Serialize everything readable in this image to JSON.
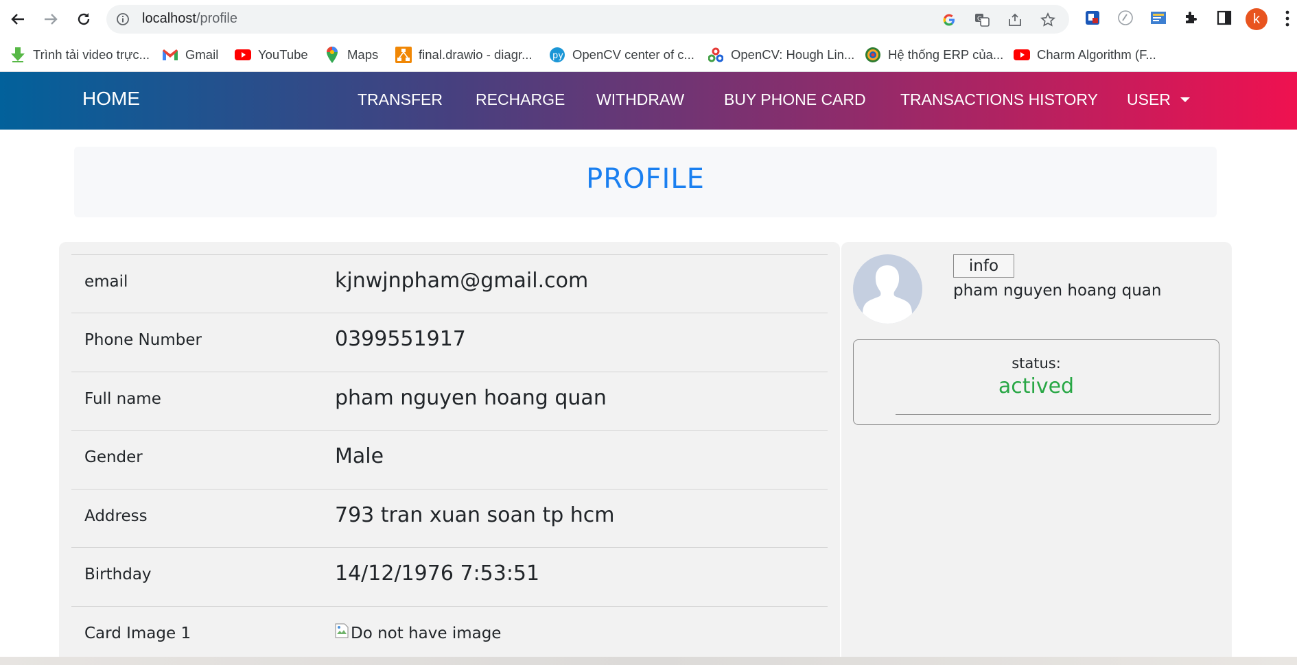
{
  "browser": {
    "url_host": "localhost",
    "url_path": "/profile",
    "profile_initial": "k",
    "bookmarks": [
      {
        "label": "Trình tải video trực...",
        "icon": "download-arrow-icon"
      },
      {
        "label": "Gmail",
        "icon": "gmail-icon"
      },
      {
        "label": "YouTube",
        "icon": "youtube-icon"
      },
      {
        "label": "Maps",
        "icon": "maps-pin-icon"
      },
      {
        "label": "final.drawio - diagr...",
        "icon": "drawio-icon"
      },
      {
        "label": "OpenCV center of c...",
        "icon": "pyimagesearch-icon"
      },
      {
        "label": "OpenCV: Hough Lin...",
        "icon": "opencv-icon"
      },
      {
        "label": "Hệ thống ERP của...",
        "icon": "erp-icon"
      },
      {
        "label": "Charm Algorithm (F...",
        "icon": "youtube-icon"
      }
    ]
  },
  "nav": {
    "brand": "HOME",
    "links": [
      "TRANSFER",
      "RECHARGE",
      "WITHDRAW",
      "BUY PHONE CARD",
      "TRANSACTIONS HISTORY"
    ],
    "user": "USER"
  },
  "page": {
    "title": "PROFILE"
  },
  "profile": {
    "rows": [
      {
        "label": "email",
        "value": "kjnwjnpham@gmail.com"
      },
      {
        "label": "Phone Number",
        "value": "0399551917"
      },
      {
        "label": "Full name",
        "value": "pham nguyen hoang quan"
      },
      {
        "label": "Gender",
        "value": "Male"
      },
      {
        "label": "Address",
        "value": "793 tran xuan soan tp hcm"
      },
      {
        "label": "Birthday",
        "value": "14/12/1976 7:53:51"
      },
      {
        "label": "Card Image 1",
        "value": "Do not have image"
      }
    ]
  },
  "side": {
    "info_button": "info",
    "name": "pham nguyen hoang quan",
    "status_label": "status:",
    "status_value": "actived",
    "status_color": "#28a745"
  }
}
